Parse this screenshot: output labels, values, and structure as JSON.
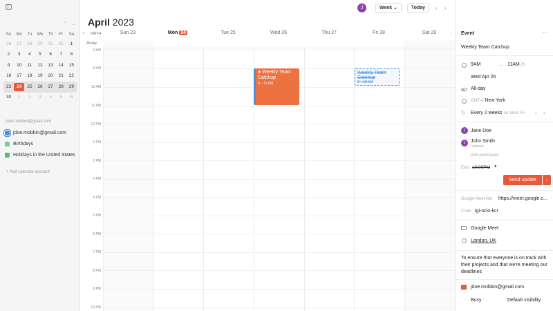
{
  "sidebar": {
    "mini_calendar": {
      "weekdays": [
        "Su",
        "Mo",
        "Tu",
        "We",
        "Th",
        "Fr",
        "Sa"
      ],
      "weeks": [
        [
          "26",
          "27",
          "28",
          "29",
          "30",
          "31",
          "1"
        ],
        [
          "2",
          "3",
          "4",
          "5",
          "6",
          "7",
          "8"
        ],
        [
          "9",
          "10",
          "11",
          "12",
          "13",
          "14",
          "15"
        ],
        [
          "16",
          "17",
          "18",
          "19",
          "20",
          "21",
          "22"
        ],
        [
          "23",
          "24",
          "25",
          "26",
          "27",
          "28",
          "29"
        ],
        [
          "30",
          "1",
          "2",
          "3",
          "4",
          "5",
          "6"
        ]
      ],
      "prev_icon": "chevron-up-icon",
      "next_icon": "chevron-down-icon"
    },
    "account_email": "jdoe.mobbin@gmail.com",
    "calendars": [
      {
        "label": "jdoe.mobbin@gmail.com",
        "color": "#4a8fdb"
      },
      {
        "label": "Birthdays",
        "color": "#7dc89a"
      },
      {
        "label": "Holidays in the United States",
        "color": "#5bb878"
      }
    ],
    "add_account": "Add calendar account"
  },
  "header": {
    "month": "April",
    "year": "2023",
    "avatar_initial": "J",
    "view_label": "Week",
    "today_label": "Today"
  },
  "week": {
    "tz": "GMT-4",
    "allday": "All-day",
    "days": [
      {
        "label": "Sun 23"
      },
      {
        "label": "Mon",
        "num": "24"
      },
      {
        "label": "Tue 25"
      },
      {
        "label": "Wed 26"
      },
      {
        "label": "Thu 27"
      },
      {
        "label": "Fri 28"
      },
      {
        "label": "Sat 29"
      }
    ],
    "hours": [
      "9 AM",
      "10 AM",
      "11 AM",
      "12 PM",
      "1 PM",
      "2 PM",
      "3 PM",
      "4 PM",
      "5 PM",
      "6 PM",
      "7 PM",
      "8 PM",
      "9 PM",
      "10 PM"
    ],
    "event": {
      "title": "Weekly Team Catchup",
      "time": "9 – 11 AM"
    },
    "ghost_event": {
      "title": "Weekly Team Catchup",
      "time": "9 – 10 AM"
    }
  },
  "panel": {
    "heading": "Event",
    "title": "Weekly Team Catchup",
    "start": "9AM",
    "end": "11AM",
    "duration": "2h",
    "date": "Wed Apr 26",
    "allday": "All-day",
    "tz_offset": "GMT-4",
    "tz_name": "New York",
    "repeat": "Every 2 weeks",
    "repeat_on": "on Wed, Fri",
    "participants": [
      {
        "name": "Jane Doe",
        "initial": "J",
        "color": "#8e44ad"
      },
      {
        "name": "John Smith",
        "initial": "J",
        "color": "#8e44ad",
        "note": "Optional"
      }
    ],
    "add_participant": "Add participant",
    "end_label": "End",
    "end_time": "10:00PM",
    "send_update": "Send update",
    "meet_label": "Google Meet link",
    "meet_url": "https://meet.google.c...",
    "code_label": "Code",
    "code": "igi-ocio-kcr",
    "meet_name": "Google Meet",
    "location": "London, UK",
    "description": "To ensure that everyone is on track with their projects and that we're meeting our deadlines",
    "organizer": "jdoe.mobbin@gmail.com",
    "busy": "Busy",
    "visibility": "Default visibility"
  }
}
